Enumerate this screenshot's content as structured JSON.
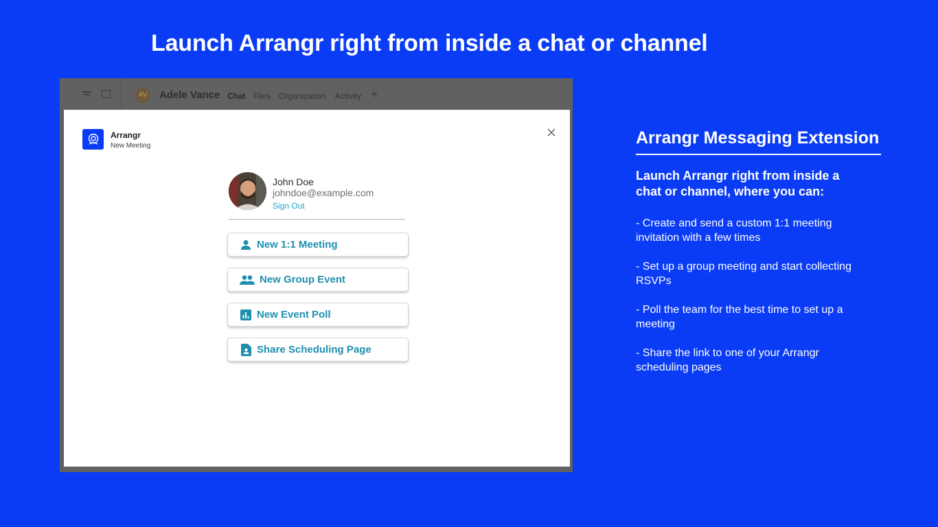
{
  "headline": "Launch Arrangr right from inside a chat or channel",
  "teams": {
    "avatar_initials": "AV",
    "user_name": "Adele Vance",
    "tabs": [
      "Chat",
      "Files",
      "Organization",
      "Activity"
    ],
    "active_tab": "Chat",
    "add_tab": "+"
  },
  "dialog": {
    "app_name": "Arrangr",
    "app_subtitle": "New Meeting",
    "close": "×",
    "profile": {
      "name": "John Doe",
      "email": "johndoe@example.com",
      "sign_out": "Sign Out"
    },
    "actions": [
      {
        "label": "New 1:1 Meeting",
        "icon": "person-icon"
      },
      {
        "label": "New Group Event",
        "icon": "people-icon"
      },
      {
        "label": "New Event Poll",
        "icon": "poll-chart-icon"
      },
      {
        "label": "Share Scheduling Page",
        "icon": "contact-page-icon"
      }
    ]
  },
  "panel": {
    "title": "Arrangr Messaging Extension",
    "intro": "Launch Arrangr right from inside a chat or channel, where you can:",
    "items": [
      "- Create and send a custom 1:1 meeting invitation with a few times",
      "- Set up a group meeting and start collecting RSVPs",
      "- Poll the team for the best time to set up a meeting",
      "- Share the link to one of your Arrangr scheduling pages"
    ]
  },
  "colors": {
    "background": "#0a3cf5",
    "accent": "#1f8fae",
    "link": "#1aa6c9"
  }
}
